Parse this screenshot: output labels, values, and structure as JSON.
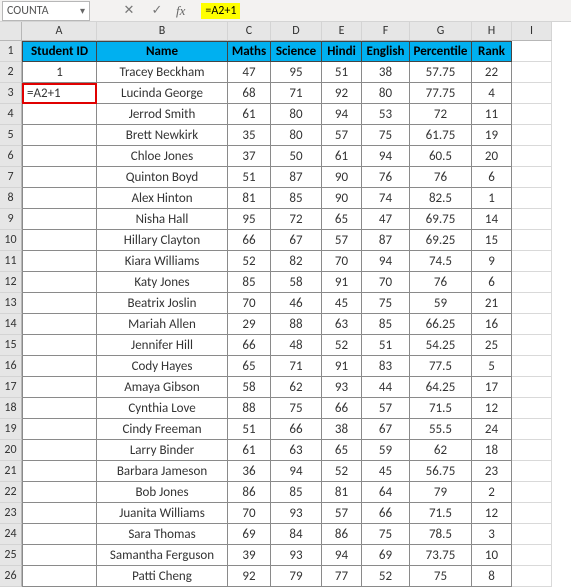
{
  "namebox": "COUNTA",
  "formula": "=A2+1",
  "col_letters": [
    "A",
    "B",
    "C",
    "D",
    "E",
    "F",
    "G",
    "H",
    "I"
  ],
  "headers": [
    "Student ID",
    "Name",
    "Maths",
    "Science",
    "Hindi",
    "English",
    "Percentile",
    "Rank"
  ],
  "active_cell_value": "=A2+1",
  "row_1_first": "1",
  "rows": [
    {
      "r": 2,
      "id": "1",
      "name": "Tracey Beckham",
      "m": "47",
      "s": "95",
      "h": "51",
      "e": "38",
      "p": "57.75",
      "rk": "22"
    },
    {
      "r": 3,
      "id": "=A2+1",
      "name": "Lucinda George",
      "m": "68",
      "s": "71",
      "h": "92",
      "e": "80",
      "p": "77.75",
      "rk": "4"
    },
    {
      "r": 4,
      "id": "",
      "name": "Jerrod Smith",
      "m": "61",
      "s": "80",
      "h": "94",
      "e": "53",
      "p": "72",
      "rk": "11"
    },
    {
      "r": 5,
      "id": "",
      "name": "Brett Newkirk",
      "m": "35",
      "s": "80",
      "h": "57",
      "e": "75",
      "p": "61.75",
      "rk": "19"
    },
    {
      "r": 6,
      "id": "",
      "name": "Chloe Jones",
      "m": "37",
      "s": "50",
      "h": "61",
      "e": "94",
      "p": "60.5",
      "rk": "20"
    },
    {
      "r": 7,
      "id": "",
      "name": "Quinton Boyd",
      "m": "51",
      "s": "87",
      "h": "90",
      "e": "76",
      "p": "76",
      "rk": "6"
    },
    {
      "r": 8,
      "id": "",
      "name": "Alex Hinton",
      "m": "81",
      "s": "85",
      "h": "90",
      "e": "74",
      "p": "82.5",
      "rk": "1"
    },
    {
      "r": 9,
      "id": "",
      "name": "Nisha Hall",
      "m": "95",
      "s": "72",
      "h": "65",
      "e": "47",
      "p": "69.75",
      "rk": "14"
    },
    {
      "r": 10,
      "id": "",
      "name": "Hillary Clayton",
      "m": "66",
      "s": "67",
      "h": "57",
      "e": "87",
      "p": "69.25",
      "rk": "15"
    },
    {
      "r": 11,
      "id": "",
      "name": "Kiara Williams",
      "m": "52",
      "s": "82",
      "h": "70",
      "e": "94",
      "p": "74.5",
      "rk": "9"
    },
    {
      "r": 12,
      "id": "",
      "name": "Katy Jones",
      "m": "85",
      "s": "58",
      "h": "91",
      "e": "70",
      "p": "76",
      "rk": "6"
    },
    {
      "r": 13,
      "id": "",
      "name": "Beatrix Joslin",
      "m": "70",
      "s": "46",
      "h": "45",
      "e": "75",
      "p": "59",
      "rk": "21"
    },
    {
      "r": 14,
      "id": "",
      "name": "Mariah Allen",
      "m": "29",
      "s": "88",
      "h": "63",
      "e": "85",
      "p": "66.25",
      "rk": "16"
    },
    {
      "r": 15,
      "id": "",
      "name": "Jennifer Hill",
      "m": "66",
      "s": "48",
      "h": "52",
      "e": "51",
      "p": "54.25",
      "rk": "25"
    },
    {
      "r": 16,
      "id": "",
      "name": "Cody Hayes",
      "m": "65",
      "s": "71",
      "h": "91",
      "e": "83",
      "p": "77.5",
      "rk": "5"
    },
    {
      "r": 17,
      "id": "",
      "name": "Amaya Gibson",
      "m": "58",
      "s": "62",
      "h": "93",
      "e": "44",
      "p": "64.25",
      "rk": "17"
    },
    {
      "r": 18,
      "id": "",
      "name": "Cynthia Love",
      "m": "88",
      "s": "75",
      "h": "66",
      "e": "57",
      "p": "71.5",
      "rk": "12"
    },
    {
      "r": 19,
      "id": "",
      "name": "Cindy Freeman",
      "m": "51",
      "s": "66",
      "h": "38",
      "e": "67",
      "p": "55.5",
      "rk": "24"
    },
    {
      "r": 20,
      "id": "",
      "name": "Larry Binder",
      "m": "61",
      "s": "63",
      "h": "65",
      "e": "59",
      "p": "62",
      "rk": "18"
    },
    {
      "r": 21,
      "id": "",
      "name": "Barbara Jameson",
      "m": "36",
      "s": "94",
      "h": "52",
      "e": "45",
      "p": "56.75",
      "rk": "23"
    },
    {
      "r": 22,
      "id": "",
      "name": "Bob Jones",
      "m": "86",
      "s": "85",
      "h": "81",
      "e": "64",
      "p": "79",
      "rk": "2"
    },
    {
      "r": 23,
      "id": "",
      "name": "Juanita Williams",
      "m": "70",
      "s": "93",
      "h": "57",
      "e": "66",
      "p": "71.5",
      "rk": "12"
    },
    {
      "r": 24,
      "id": "",
      "name": "Sara Thomas",
      "m": "69",
      "s": "84",
      "h": "86",
      "e": "75",
      "p": "78.5",
      "rk": "3"
    },
    {
      "r": 25,
      "id": "",
      "name": "Samantha Ferguson",
      "m": "39",
      "s": "93",
      "h": "94",
      "e": "69",
      "p": "73.75",
      "rk": "10"
    },
    {
      "r": 26,
      "id": "",
      "name": "Patti Cheng",
      "m": "92",
      "s": "79",
      "h": "77",
      "e": "52",
      "p": "75",
      "rk": "8"
    }
  ]
}
